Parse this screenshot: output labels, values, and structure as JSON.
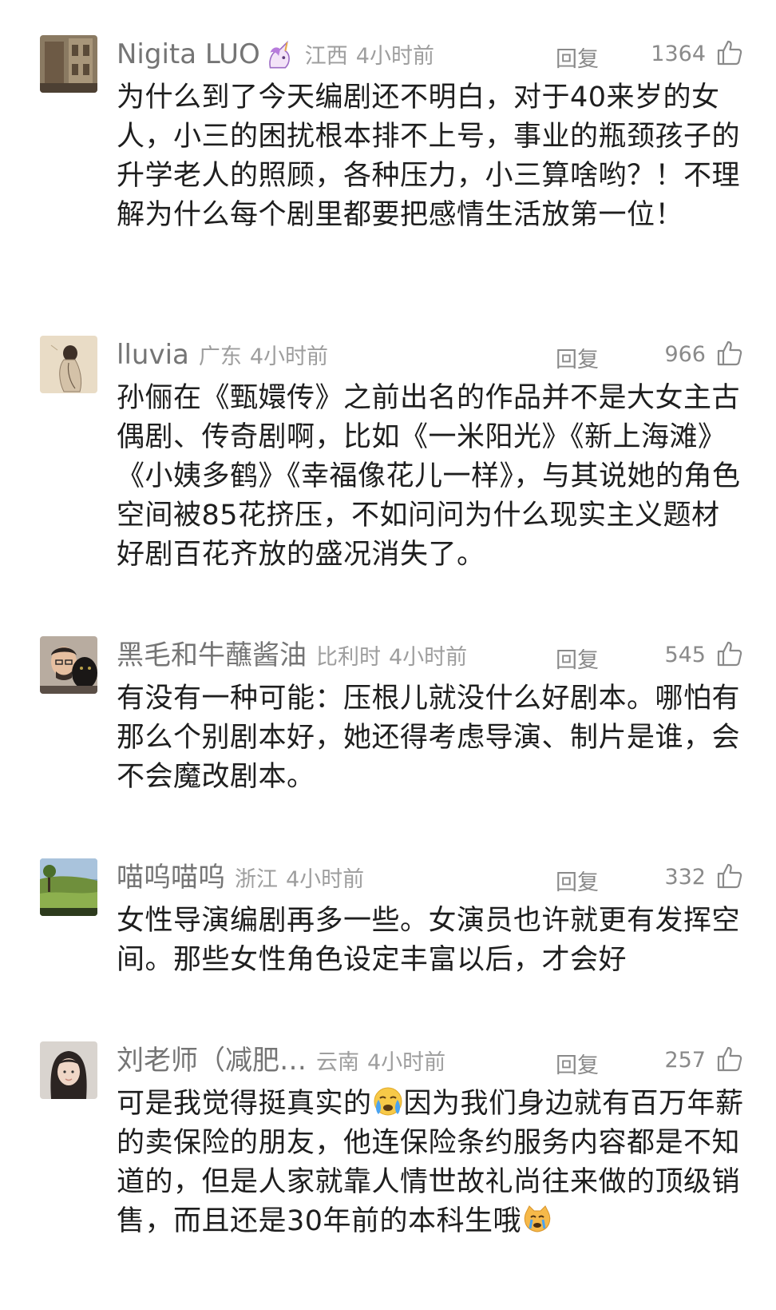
{
  "comments": [
    {
      "username": "Nigita LUO",
      "location": "江西",
      "time": "4小时前",
      "reply_label": "回复",
      "likes": "1364",
      "text": "为什么到了今天编剧还不明白，对于40来岁的女人，小三的困扰根本排不上号，事业的瓶颈孩子的升学老人的照顾，各种压力，小三算啥哟？！不理解为什么每个剧里都要把感情生活放第一位！"
    },
    {
      "username": "lluvia",
      "location": "广东",
      "time": "4小时前",
      "reply_label": "回复",
      "likes": "966",
      "text": "孙俪在《甄嬛传》之前出名的作品并不是大女主古偶剧、传奇剧啊，比如《一米阳光》《新上海滩》《小姨多鹤》《幸福像花儿一样》，与其说她的角色空间被85花挤压，不如问问为什么现实主义题材好剧百花齐放的盛况消失了。"
    },
    {
      "username": "黑毛和牛蘸酱油",
      "location": "比利时",
      "time": "4小时前",
      "reply_label": "回复",
      "likes": "545",
      "text": "有没有一种可能：压根儿就没什么好剧本。哪怕有那么个别剧本好，她还得考虑导演、制片是谁，会不会魔改剧本。"
    },
    {
      "username": "喵呜喵呜",
      "location": "浙江",
      "time": "4小时前",
      "reply_label": "回复",
      "likes": "332",
      "text": "女性导演编剧再多一些。女演员也许就更有发挥空间。那些女性角色设定丰富以后，才会好"
    },
    {
      "username": "刘老师（减肥…",
      "location": "云南",
      "time": "4小时前",
      "reply_label": "回复",
      "likes": "257",
      "text_a": "可是我觉得挺真实的",
      "text_b": "因为我们身边就有百万年薪的卖保险的朋友，他连保险条约服务内容都是不知道的，但是人家就靠人情世故礼尚往来做的顶级销售，而且还是30年前的本科生哦"
    }
  ],
  "icons": {
    "badge": "unicorn-badge-icon",
    "like": "thumbs-up-icon",
    "emoji_crying": "crying-face-emoji",
    "emoji_cat": "crying-cat-emoji"
  },
  "colors": {
    "username": "#757575",
    "meta": "#9e9e9e",
    "text": "#1e1e1e"
  }
}
